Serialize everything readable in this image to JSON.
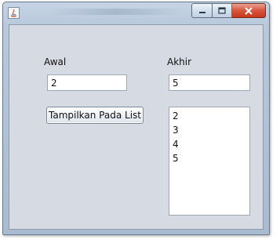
{
  "window": {
    "title": ""
  },
  "caption": {
    "minimize_icon": "minimize-icon",
    "maximize_icon": "maximize-icon",
    "close_icon": "close-icon"
  },
  "form": {
    "awal_label": "Awal",
    "akhir_label": "Akhir",
    "awal_value": "2",
    "akhir_value": "5",
    "button_label": "Tampilkan Pada List",
    "list_items": [
      "2",
      "3",
      "4",
      "5"
    ]
  },
  "colors": {
    "client_background": "#d5dae3",
    "close_button": "#d7553b",
    "field_background": "#ffffff"
  }
}
